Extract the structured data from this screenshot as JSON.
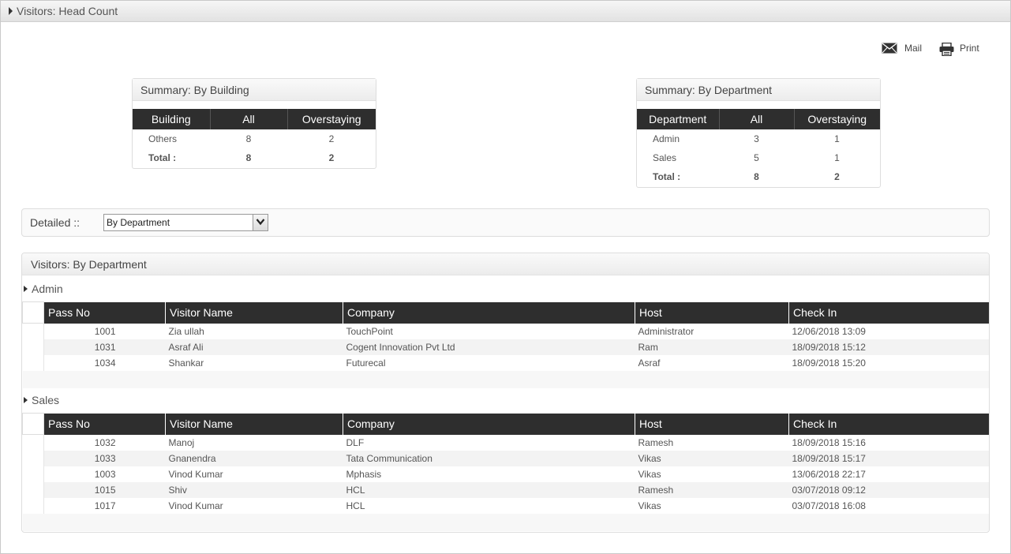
{
  "window": {
    "title": "Visitors: Head Count"
  },
  "toolbar": {
    "mail_label": "Mail",
    "print_label": "Print"
  },
  "summary_building": {
    "title": "Summary: By Building",
    "headers": [
      "Building",
      "All",
      "Overstaying"
    ],
    "rows": [
      [
        "Others",
        "8",
        "2"
      ]
    ],
    "total": [
      "Total :",
      "8",
      "2"
    ]
  },
  "summary_department": {
    "title": "Summary: By Department",
    "headers": [
      "Department",
      "All",
      "Overstaying"
    ],
    "rows": [
      [
        "Admin",
        "3",
        "1"
      ],
      [
        "Sales",
        "5",
        "1"
      ]
    ],
    "total": [
      "Total :",
      "8",
      "2"
    ]
  },
  "detailed": {
    "label": "Detailed ::",
    "selected": "By Department"
  },
  "visitors": {
    "title": "Visitors: By Department",
    "columns": [
      "Pass No",
      "Visitor Name",
      "Company",
      "Host",
      "Check In"
    ],
    "groups": [
      {
        "name": "Admin",
        "rows": [
          [
            "1001",
            "Zia ullah",
            "TouchPoint",
            "Administrator",
            "12/06/2018 13:09"
          ],
          [
            "1031",
            "Asraf Ali",
            "Cogent Innovation Pvt Ltd",
            "Ram",
            "18/09/2018 15:12"
          ],
          [
            "1034",
            "Shankar",
            "Futurecal",
            "Asraf",
            "18/09/2018 15:20"
          ]
        ]
      },
      {
        "name": "Sales",
        "rows": [
          [
            "1032",
            "Manoj",
            "DLF",
            "Ramesh",
            "18/09/2018 15:16"
          ],
          [
            "1033",
            "Gnanendra",
            "Tata Communication",
            "Vikas",
            "18/09/2018 15:17"
          ],
          [
            "1003",
            "Vinod Kumar",
            "Mphasis",
            "Vikas",
            "13/06/2018 22:17"
          ],
          [
            "1015",
            "Shiv",
            "HCL",
            "Ramesh",
            "03/07/2018 09:12"
          ],
          [
            "1017",
            "Vinod Kumar",
            "HCL",
            "Vikas",
            "03/07/2018 16:08"
          ]
        ]
      }
    ]
  }
}
